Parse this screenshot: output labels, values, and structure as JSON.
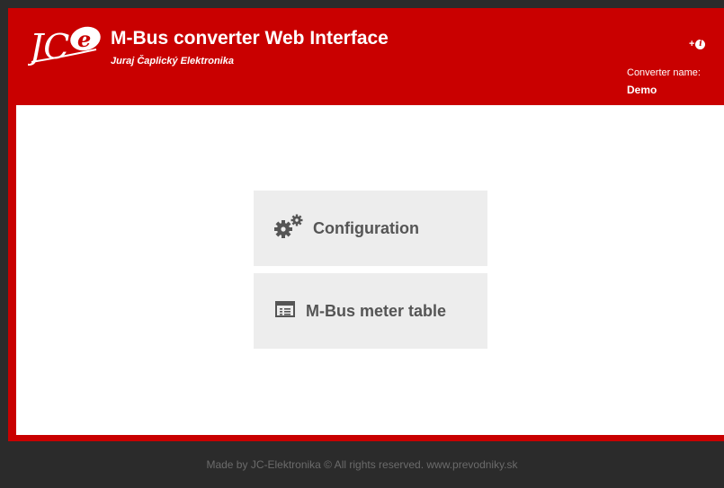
{
  "header": {
    "title": "M-Bus converter Web Interface",
    "subtitle": "Juraj Čaplický Elektronika",
    "logo_text": "JC-e",
    "info_plus": "+",
    "info_icon": "info-icon",
    "converter_label": "Converter name:",
    "converter_name": "Demo"
  },
  "menu": {
    "items": [
      {
        "label": "Configuration",
        "icon": "gears-icon"
      },
      {
        "label": "M-Bus meter table",
        "icon": "table-icon"
      }
    ]
  },
  "footer": {
    "text": "Made by JC-Elektronika © All rights reserved. www.prevodniky.sk"
  },
  "colors": {
    "brand": "#c90000",
    "background": "#2b2b2b",
    "tile": "#ededed",
    "tile_text": "#555555"
  }
}
